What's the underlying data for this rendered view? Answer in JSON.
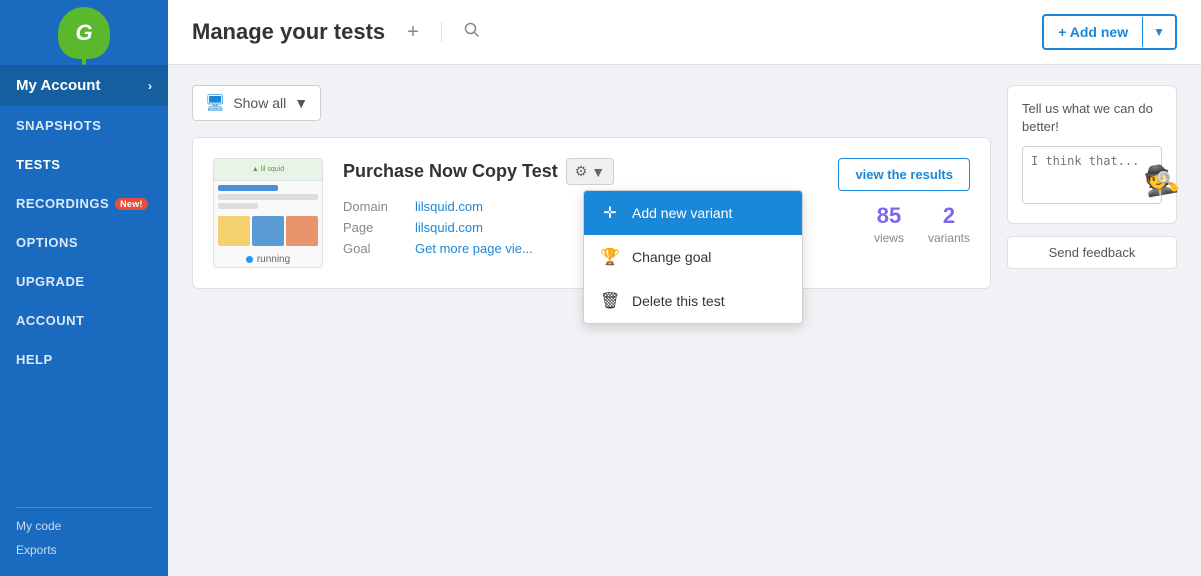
{
  "sidebar": {
    "logo_letter": "G",
    "my_account_label": "My Account",
    "my_account_chevron": "›",
    "nav_items": [
      {
        "id": "snapshots",
        "label": "SNAPSHOTS",
        "badge": null
      },
      {
        "id": "tests",
        "label": "TESTS",
        "badge": null
      },
      {
        "id": "recordings",
        "label": "RECORDINGS",
        "badge": "New!"
      },
      {
        "id": "options",
        "label": "OPTIONS",
        "badge": null
      },
      {
        "id": "upgrade",
        "label": "UPGRADE",
        "badge": null
      },
      {
        "id": "account",
        "label": "ACCOUNT",
        "badge": null
      },
      {
        "id": "help",
        "label": "HELP",
        "badge": null
      }
    ],
    "bottom_links": [
      {
        "id": "my-code",
        "label": "My code"
      },
      {
        "id": "exports",
        "label": "Exports"
      }
    ]
  },
  "header": {
    "title": "Manage your tests",
    "add_icon": "+",
    "search_icon": "🔍",
    "add_new_label": "+ Add new",
    "add_new_dropdown": "▼"
  },
  "filter": {
    "icon": "🖥",
    "label": "Show all",
    "chevron": "▼"
  },
  "test_card": {
    "name": "Purchase Now Copy Test",
    "domain_label": "Domain",
    "domain_value": "lilsquid.com",
    "page_label": "Page",
    "page_value": "lilsquid.com",
    "goal_label": "Goal",
    "goal_value": "Get more page vie...",
    "status": "running",
    "views": "85",
    "views_label": "views",
    "variants": "2",
    "variants_label": "variants",
    "view_results_label": "view the results"
  },
  "dropdown": {
    "items": [
      {
        "id": "add-variant",
        "label": "Add new variant",
        "icon": "✛",
        "highlighted": true
      },
      {
        "id": "change-goal",
        "label": "Change goal",
        "icon": "🏆",
        "highlighted": false
      },
      {
        "id": "delete-test",
        "label": "Delete this test",
        "icon": "🗑",
        "highlighted": false
      }
    ]
  },
  "feedback": {
    "prompt": "Tell us what we can do better!",
    "placeholder": "I think that...",
    "send_label": "Send feedback"
  }
}
